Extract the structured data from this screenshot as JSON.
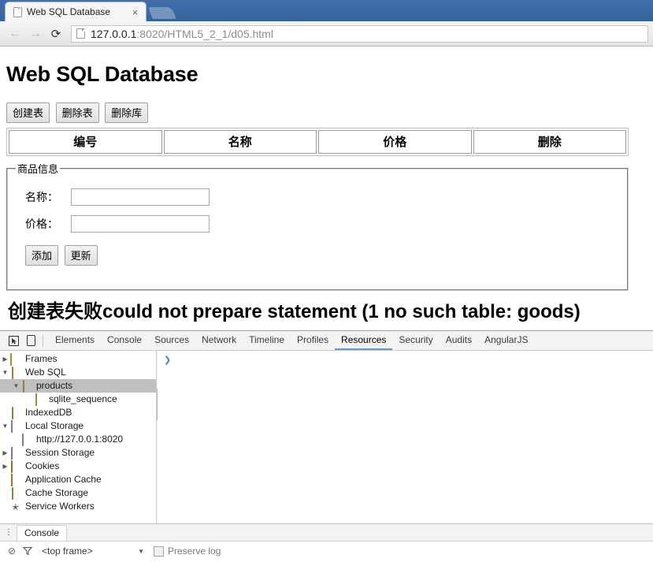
{
  "browser": {
    "tab": {
      "title": "Web SQL Database",
      "favicon": "page-icon",
      "close": "×"
    },
    "new_tab_label": "",
    "nav": {
      "back": "←",
      "forward": "→",
      "reload": "⟳"
    },
    "omnibox": {
      "host": "127.0.0.1",
      "rest": ":8020/HTML5_2_1/d05.html"
    }
  },
  "page": {
    "title": "Web SQL Database",
    "buttons": [
      {
        "label": "创建表"
      },
      {
        "label": "删除表"
      },
      {
        "label": "删除库"
      }
    ],
    "table": {
      "headers": [
        "编号",
        "名称",
        "价格",
        "删除"
      ],
      "rows": []
    },
    "fieldset": {
      "legend": "商品信息",
      "fields": [
        {
          "label": "名称：",
          "value": "",
          "placeholder": ""
        },
        {
          "label": "价格：",
          "value": "",
          "placeholder": ""
        }
      ],
      "actions": [
        {
          "label": "添加"
        },
        {
          "label": "更新"
        }
      ]
    },
    "error_message": "创建表失败could not prepare statement (1 no such table: goods)"
  },
  "devtools": {
    "toolbar_icons": [
      {
        "name": "inspect-element-icon",
        "glyph": "⬚"
      },
      {
        "name": "device-toolbar-icon",
        "glyph": "▯"
      }
    ],
    "tabs": [
      {
        "label": "Elements",
        "active": false
      },
      {
        "label": "Console",
        "active": false
      },
      {
        "label": "Sources",
        "active": false
      },
      {
        "label": "Network",
        "active": false
      },
      {
        "label": "Timeline",
        "active": false
      },
      {
        "label": "Profiles",
        "active": false
      },
      {
        "label": "Resources",
        "active": true
      },
      {
        "label": "Security",
        "active": false
      },
      {
        "label": "Audits",
        "active": false
      },
      {
        "label": "AngularJS",
        "active": false
      }
    ],
    "resources_tree": [
      {
        "label": "Frames",
        "icon": "folder",
        "indent": 1,
        "twisty": "▶",
        "selected": false
      },
      {
        "label": "Web SQL",
        "icon": "database",
        "indent": 1,
        "twisty": "▼",
        "selected": false
      },
      {
        "label": "products",
        "icon": "database",
        "indent": 2,
        "twisty": "▼",
        "selected": true
      },
      {
        "label": "sqlite_sequence",
        "icon": "table",
        "indent": 3,
        "twisty": "",
        "selected": false
      },
      {
        "label": "IndexedDB",
        "icon": "database",
        "indent": 1,
        "twisty": "",
        "selected": false
      },
      {
        "label": "Local Storage",
        "icon": "storage",
        "indent": 1,
        "twisty": "▼",
        "selected": false
      },
      {
        "label": "http://127.0.0.1:8020",
        "icon": "storage",
        "indent": 2,
        "twisty": "",
        "selected": false
      },
      {
        "label": "Session Storage",
        "icon": "session",
        "indent": 1,
        "twisty": "▶",
        "selected": false
      },
      {
        "label": "Cookies",
        "icon": "cookie",
        "indent": 1,
        "twisty": "▶",
        "selected": false
      },
      {
        "label": "Application Cache",
        "icon": "appcache",
        "indent": 1,
        "twisty": "",
        "selected": false
      },
      {
        "label": "Cache Storage",
        "icon": "database",
        "indent": 1,
        "twisty": "",
        "selected": false
      },
      {
        "label": "Service Workers",
        "icon": "gear",
        "indent": 1,
        "twisty": "",
        "selected": false
      }
    ],
    "console_prompt": "❯",
    "drawer": {
      "menu_glyph": "⋮",
      "tab_label": "Console",
      "clear_icon": "⊘",
      "filter_icon": "▽",
      "frame_value": "<top frame>",
      "frame_caret": "▼",
      "preserve_log_label": "Preserve log",
      "preserve_log_checked": false
    }
  },
  "colors": {
    "tabstrip_blue": "#3c6aa6",
    "active_tab_underline": "#5a9bd5",
    "selection_gray": "#bfbfbf",
    "prompt_blue": "#4d7fc4"
  }
}
